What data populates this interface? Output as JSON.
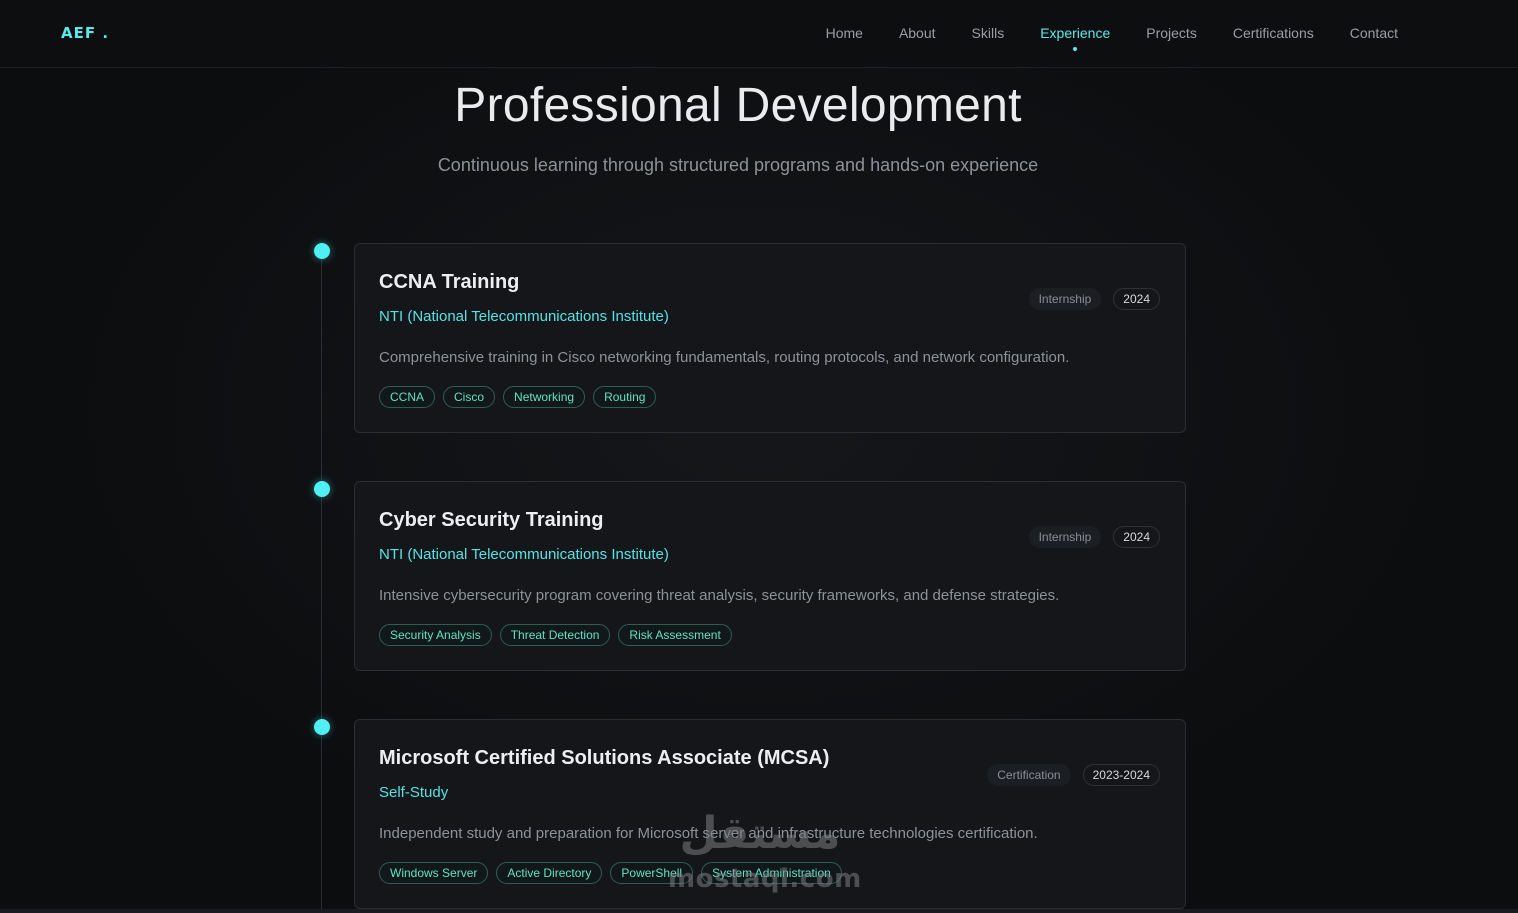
{
  "nav": {
    "logo": "AEF .",
    "links": [
      "Home",
      "About",
      "Skills",
      "Experience",
      "Projects",
      "Certifications",
      "Contact"
    ],
    "active": "Experience"
  },
  "header": {
    "title": "Professional Development",
    "subtitle": "Continuous learning through structured programs and hands-on experience"
  },
  "cards": [
    {
      "title": "CCNA Training",
      "org": "NTI (National Telecommunications Institute)",
      "type": "Internship",
      "year": "2024",
      "description": "Comprehensive training in Cisco networking fundamentals, routing protocols, and network configuration.",
      "tags": [
        "CCNA",
        "Cisco",
        "Networking",
        "Routing"
      ]
    },
    {
      "title": "Cyber Security Training",
      "org": "NTI (National Telecommunications Institute)",
      "type": "Internship",
      "year": "2024",
      "description": "Intensive cybersecurity program covering threat analysis, security frameworks, and defense strategies.",
      "tags": [
        "Security Analysis",
        "Threat Detection",
        "Risk Assessment"
      ]
    },
    {
      "title": "Microsoft Certified Solutions Associate (MCSA)",
      "org": "Self-Study",
      "type": "Certification",
      "year": "2023-2024",
      "description": "Independent study and preparation for Microsoft server and infrastructure technologies certification.",
      "tags": [
        "Windows Server",
        "Active Directory",
        "PowerShell",
        "System Administration"
      ]
    }
  ],
  "watermark": {
    "arabic": "مستقل",
    "latin": "mostaql.com"
  },
  "colors": {
    "accent": "#5ce8ea",
    "background": "#0c0d0f",
    "card": "#141619",
    "tag_text": "#5fe3c4"
  }
}
